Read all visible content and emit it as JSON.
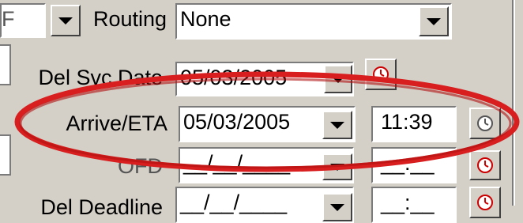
{
  "top_row": {
    "left_field_fragment": "F",
    "routing_label": "Routing",
    "routing_value": "None"
  },
  "rows": {
    "del_svc_date": {
      "label": "Del Svc Date",
      "date": "05/03/2005"
    },
    "arrive_eta": {
      "label": "Arrive/ETA",
      "date": "05/03/2005",
      "time": "11:39"
    },
    "ofd": {
      "label": "OFD",
      "date": "__/__/____",
      "time": "__:__"
    },
    "del_deadline": {
      "label": "Del Deadline",
      "date": "__/__/____",
      "time": "__:__"
    }
  },
  "icons": {
    "dropdown": "chevron-down-icon",
    "clock": "clock-icon"
  },
  "colors": {
    "highlight_ellipse": "#d81e1e",
    "window_bg": "#d4d0c8"
  }
}
